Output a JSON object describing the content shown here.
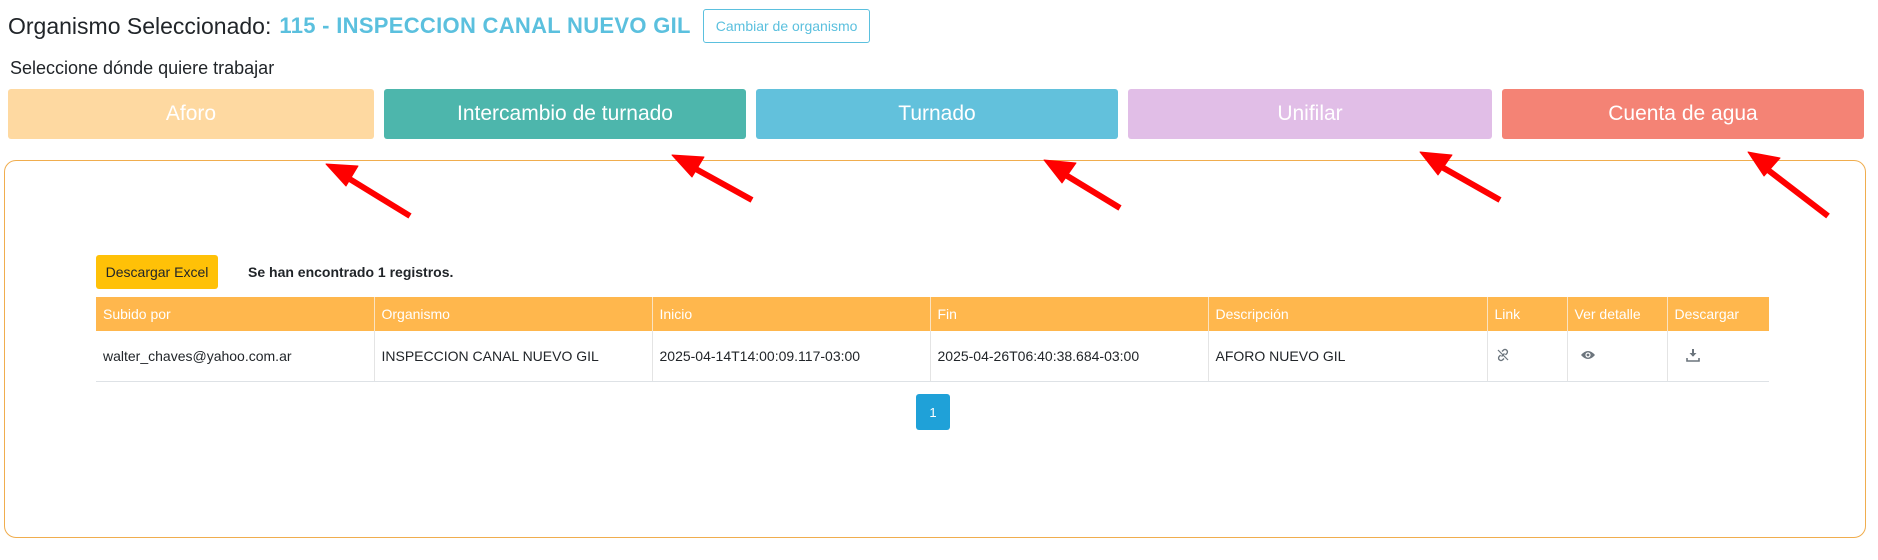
{
  "header": {
    "label": "Organismo Seleccionado:",
    "organism": "115 - INSPECCION CANAL NUEVO GIL",
    "change_button": "Cambiar de organismo"
  },
  "prompt": "Seleccione dónde quiere trabajar",
  "sections": [
    {
      "label": "Aforo",
      "color": "#fed9a1"
    },
    {
      "label": "Intercambio de turnado",
      "color": "#4db6ac"
    },
    {
      "label": "Turnado",
      "color": "#62c1dc"
    },
    {
      "label": "Unifilar",
      "color": "#e1bee7"
    },
    {
      "label": "Cuenta de agua",
      "color": "#f48375"
    }
  ],
  "panel": {
    "excel_button": "Descargar Excel",
    "records_text": "Se han encontrado 1 registros.",
    "table": {
      "columns": [
        "Subido por",
        "Organismo",
        "Inicio",
        "Fin",
        "Descripción",
        "Link",
        "Ver detalle",
        "Descargar"
      ],
      "rows": [
        {
          "uploaded_by": "walter_chaves@yahoo.com.ar",
          "organism": "INSPECCION CANAL NUEVO GIL",
          "start": "2025-04-14T14:00:09.117-03:00",
          "end": "2025-04-26T06:40:38.684-03:00",
          "description": "AFORO NUEVO GIL",
          "link_icon": "link-off-icon",
          "detail_icon": "eye-icon",
          "download_icon": "download-icon"
        }
      ]
    },
    "pagination": {
      "current_page": "1"
    }
  },
  "colors": {
    "accent_text": "#5bc0de",
    "table_header": "#ffb74d",
    "panel_border": "#f0ad4e",
    "excel_button": "#ffc107",
    "page_active": "#1fa1d8",
    "annotation_arrow": "#ff0000"
  }
}
